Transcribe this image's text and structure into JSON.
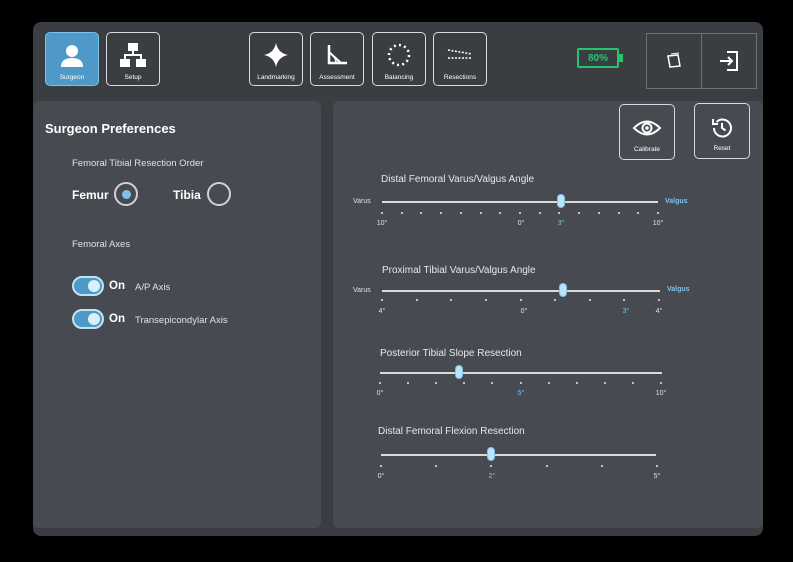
{
  "toolbar": {
    "surgeon": "Surgeon",
    "setup": "Setup",
    "landmarking": "Landmarking",
    "assessment": "Assessment",
    "balancing": "Balancing",
    "resections": "Resections"
  },
  "battery": {
    "label": "80%",
    "color": "#27c46c"
  },
  "preferences": {
    "title": "Surgeon Preferences",
    "order_label": "Femoral Tibial Resection Order",
    "option_femur": "Femur",
    "option_tibia": "Tibia",
    "selected": "Femur",
    "axes_label": "Femoral Axes",
    "ap_toggle": {
      "state": "On",
      "label": "A/P Axis"
    },
    "te_toggle": {
      "state": "On",
      "label": "Transepicondylar Axis"
    }
  },
  "actions": {
    "calibrate": "Calibrate",
    "reset": "Reset"
  },
  "sliders": {
    "dfva": {
      "title": "Distal Femoral Varus/Valgus Angle",
      "left": "Varus",
      "right": "Valgus",
      "min_label": "10°",
      "mid_label": "0°",
      "value_label": "3°",
      "max_label": "10°",
      "value": 3
    },
    "ptva": {
      "title": "Proximal Tibial Varus/Valgus Angle",
      "left": "Varus",
      "right": "Valgus",
      "min_label": "4°",
      "mid_label": "0°",
      "value_label": "3°",
      "max_label": "4°",
      "value": 3
    },
    "pts": {
      "title": "Posterior Tibial Slope Resection",
      "min_label": "0°",
      "value_label": "5°",
      "max_label": "10°",
      "value": 5
    },
    "dff": {
      "title": "Distal Femoral Flexion Resection",
      "min_label": "0°",
      "value_label": "2°",
      "max_label": "5°",
      "value": 2
    }
  },
  "colors": {
    "accent": "#7cc3ea",
    "active": "#4e99c8",
    "background": "#3a3e43",
    "panel": "#474b51"
  }
}
